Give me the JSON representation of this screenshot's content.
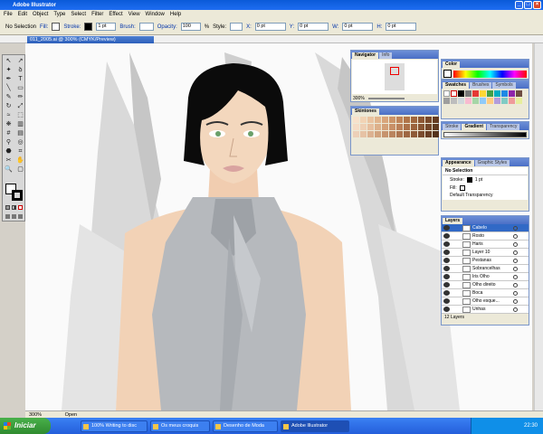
{
  "app": {
    "title": "Adobe Illustrator"
  },
  "menu": [
    "File",
    "Edit",
    "Object",
    "Type",
    "Select",
    "Filter",
    "Effect",
    "View",
    "Window",
    "Help"
  ],
  "control": {
    "selection": "No Selection",
    "fill_label": "Fill:",
    "stroke_label": "Stroke:",
    "stroke_weight": "1 pt",
    "brush_label": "Brush:",
    "opacity_label": "Opacity:",
    "opacity_value": "100",
    "percent": "%",
    "style_label": "Style:",
    "x_label": "X:",
    "y_label": "Y:",
    "w_label": "W:",
    "h_label": "H:",
    "zero_pt": "0 pt"
  },
  "document": {
    "tab": "011_2005.ai @ 300% (CMYK/Preview)"
  },
  "navigator": {
    "tabs": [
      "Navigator",
      "Info"
    ],
    "zoom": "300%"
  },
  "skintones": {
    "title": "Skintones",
    "colors": [
      "#f7e1cb",
      "#f2d3b5",
      "#eac3a0",
      "#e1b48c",
      "#d8a47a",
      "#cc9468",
      "#c08458",
      "#b07448",
      "#a0663d",
      "#8d5733",
      "#7a4929",
      "#653b21",
      "#f4dcc6",
      "#eecfb4",
      "#e7bf9e",
      "#ddb08a",
      "#d3a078",
      "#c89068",
      "#bb8058",
      "#ac7149",
      "#9b633d",
      "#885532",
      "#744729",
      "#5f3a20",
      "#edd0b8",
      "#e6c2a5",
      "#dcb291",
      "#d1a37e",
      "#c6936d",
      "#ba845e",
      "#ad7550",
      "#9e6743",
      "#8e5a38",
      "#7b4c2e",
      "#693f25",
      "#55331d"
    ]
  },
  "color_panel": {
    "tab": "Color"
  },
  "swatches": {
    "tabs": [
      "Swatches",
      "Brushes",
      "Symbols"
    ]
  },
  "stroke_panel": {
    "tabs": [
      "Stroke",
      "Gradient",
      "Transparency"
    ]
  },
  "appearance": {
    "tabs": [
      "Appearance",
      "Graphic Styles"
    ],
    "title": "No Selection",
    "stroke_label": "Stroke:",
    "stroke_value": "1 pt",
    "fill_label": "Fill:",
    "transparency": "Default Transparency"
  },
  "layers": {
    "tab": "Layers",
    "rows": [
      "Cabelo",
      "Rosto",
      "Haris",
      "Layer 10",
      "Pestanas",
      "Sobrancelhas",
      "Iris Olho",
      "Olho direito",
      "Boca",
      "Olho esque...",
      "Unhas"
    ],
    "count": "12 Layers"
  },
  "status": {
    "zoom": "300%",
    "info": "Open"
  },
  "taskbar": {
    "start": "Iniciar",
    "tasks": [
      "100% Writing to disc",
      "Os meus croquis",
      "Desenho de Moda",
      "Adobe Illustrator"
    ],
    "time": "22:30"
  },
  "colors": {
    "accent": "#0a5ad8",
    "hair": "#0b0b0b",
    "skin": "#f2d2b6",
    "dress": "#b6b9bd"
  }
}
